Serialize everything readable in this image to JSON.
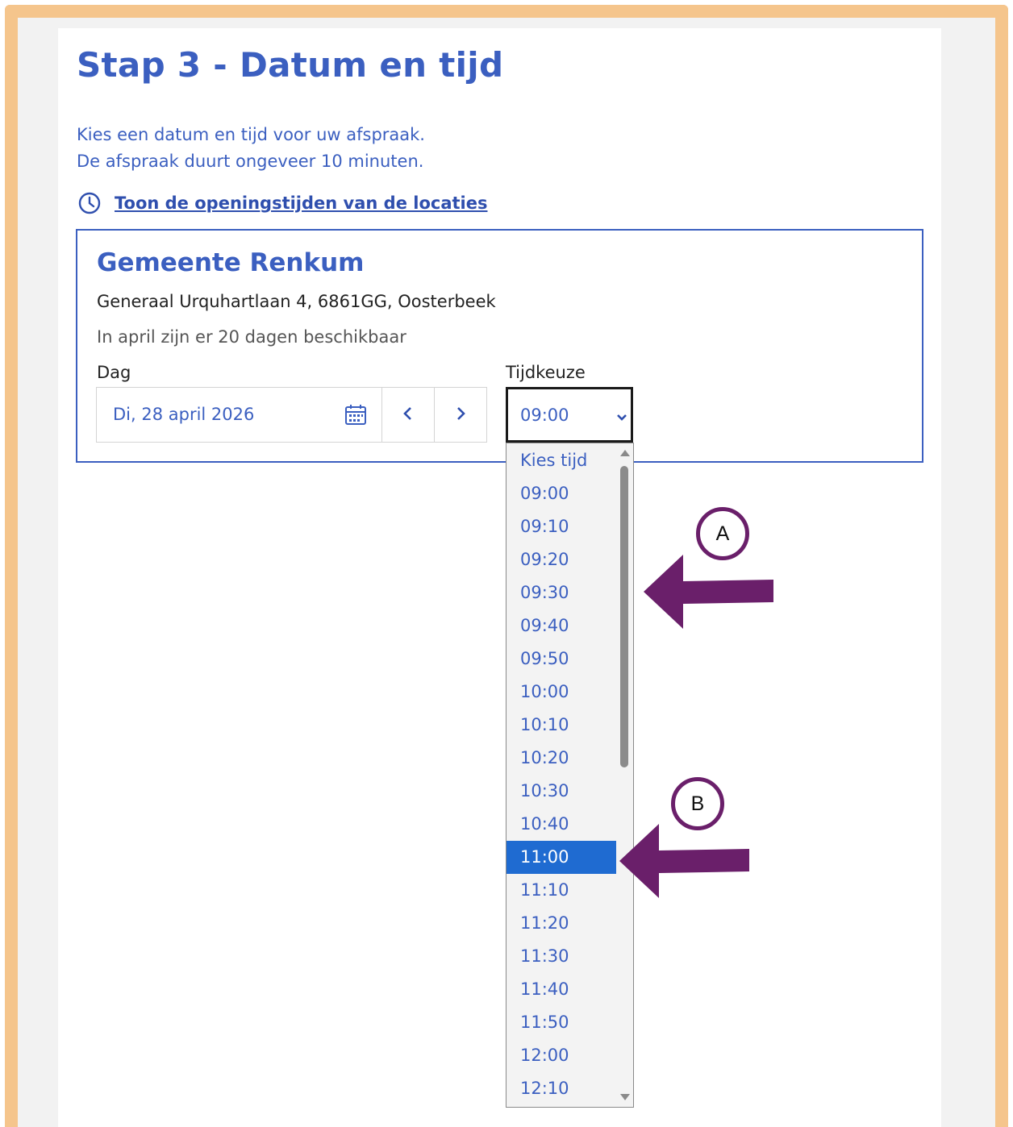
{
  "page": {
    "title": "Stap 3 - Datum en tijd",
    "intro_line1": "Kies een datum en tijd voor uw afspraak.",
    "intro_line2": "De afspraak duurt ongeveer 10 minuten.",
    "opening_hours_link": "Toon de openingstijden van de locaties"
  },
  "location": {
    "name": "Gemeente Renkum",
    "address": "Generaal Urquhartlaan 4, 6861GG, Oosterbeek",
    "availability": "In april zijn er 20 dagen beschikbaar"
  },
  "day": {
    "label": "Dag",
    "value": "Di, 28 april 2026"
  },
  "time": {
    "label": "Tijdkeuze",
    "value": "09:00",
    "options": [
      "Kies tijd",
      "09:00",
      "09:10",
      "09:20",
      "09:30",
      "09:40",
      "09:50",
      "10:00",
      "10:10",
      "10:20",
      "10:30",
      "10:40",
      "11:00",
      "11:10",
      "11:20",
      "11:30",
      "11:40",
      "11:50",
      "12:00",
      "12:10"
    ],
    "highlighted_option": "11:00"
  },
  "annotations": {
    "marker_a": "A",
    "marker_b": "B",
    "arrow_color": "#6a1f6a"
  },
  "colors": {
    "frame": "#f5c58c",
    "accent": "#3b5fc0",
    "selected_option": "#1f6bd1"
  }
}
